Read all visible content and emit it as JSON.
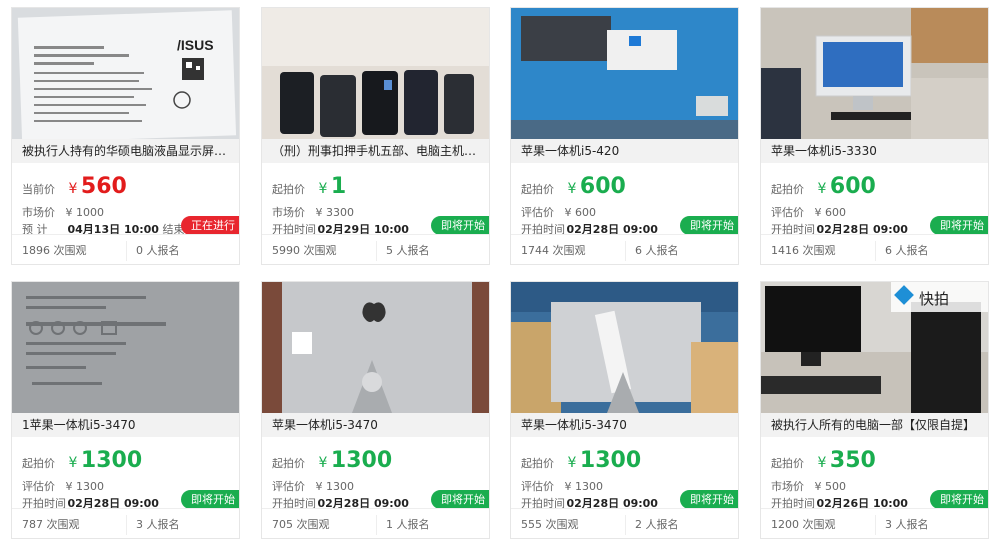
{
  "colors": {
    "price_red": "#e21c1c",
    "price_green": "#1aad4f",
    "badge_active": "#e8262e",
    "badge_upcoming": "#1aad4f"
  },
  "items": [
    {
      "title": "被执行人持有的华硕电脑液晶显示屏一…",
      "price_label": "当前价",
      "currency": "¥",
      "price": "560",
      "price_color": "red",
      "market_label": "市场价",
      "market_value": "¥ 1000",
      "time_label": "预  计",
      "time_value": "04月13日 10:00",
      "time_suffix": "结束",
      "status": "正在进行",
      "status_color": "red",
      "views": "1896 次围观",
      "signups": "0 人报名",
      "thumb_icon": "asus-label-photo"
    },
    {
      "title": "（刑）刑事扣押手机五部、电脑主机一…",
      "price_label": "起拍价",
      "currency": "¥",
      "price": "1",
      "price_color": "green",
      "market_label": "市场价",
      "market_value": "¥ 3300",
      "time_label": "开拍时间",
      "time_value": "02月29日 10:00",
      "time_suffix": "",
      "status": "即将开始",
      "status_color": "green",
      "views": "5990 次围观",
      "signups": "5 人报名",
      "thumb_icon": "phones-photo"
    },
    {
      "title": "苹果一体机i5-420",
      "price_label": "起拍价",
      "currency": "¥",
      "price": "600",
      "price_color": "green",
      "market_label": "评估价",
      "market_value": "¥ 600",
      "time_label": "开拍时间",
      "time_value": "02月28日 09:00",
      "time_suffix": "",
      "status": "即将开始",
      "status_color": "green",
      "views": "1744 次围观",
      "signups": "6 人报名",
      "thumb_icon": "imac-screen-photo"
    },
    {
      "title": "苹果一体机i5-3330",
      "price_label": "起拍价",
      "currency": "¥",
      "price": "600",
      "price_color": "green",
      "market_label": "评估价",
      "market_value": "¥ 600",
      "time_label": "开拍时间",
      "time_value": "02月28日 09:00",
      "time_suffix": "",
      "status": "即将开始",
      "status_color": "green",
      "views": "1416 次围观",
      "signups": "6 人报名",
      "thumb_icon": "imac-desk-photo"
    },
    {
      "title": "1苹果一体机i5-3470",
      "price_label": "起拍价",
      "currency": "¥",
      "price": "1300",
      "price_color": "green",
      "market_label": "评估价",
      "market_value": "¥ 1300",
      "time_label": "开拍时间",
      "time_value": "02月28日 09:00",
      "time_suffix": "",
      "status": "即将开始",
      "status_color": "green",
      "views": "787 次围观",
      "signups": "3 人报名",
      "thumb_icon": "label-closeup-photo"
    },
    {
      "title": "苹果一体机i5-3470",
      "price_label": "起拍价",
      "currency": "¥",
      "price": "1300",
      "price_color": "green",
      "market_label": "评估价",
      "market_value": "¥ 1300",
      "time_label": "开拍时间",
      "time_value": "02月28日 09:00",
      "time_suffix": "",
      "status": "即将开始",
      "status_color": "green",
      "views": "705 次围观",
      "signups": "1 人报名",
      "thumb_icon": "imac-back-photo"
    },
    {
      "title": "苹果一体机i5-3470",
      "price_label": "起拍价",
      "currency": "¥",
      "price": "1300",
      "price_color": "green",
      "market_label": "评估价",
      "market_value": "¥ 1300",
      "time_label": "开拍时间",
      "time_value": "02月28日 09:00",
      "time_suffix": "",
      "status": "即将开始",
      "status_color": "green",
      "views": "555 次围观",
      "signups": "2 人报名",
      "thumb_icon": "imac-back-sealed-photo"
    },
    {
      "title": "被执行人所有的电脑一部【仅限自提】",
      "price_label": "起拍价",
      "currency": "¥",
      "price": "350",
      "price_color": "green",
      "market_label": "市场价",
      "market_value": "¥ 500",
      "time_label": "开拍时间",
      "time_value": "02月26日 10:00",
      "time_suffix": "",
      "status": "即将开始",
      "status_color": "green",
      "views": "1200 次围观",
      "signups": "3 人报名",
      "thumb_icon": "desktop-pc-photo",
      "watermark": "快拍"
    }
  ]
}
